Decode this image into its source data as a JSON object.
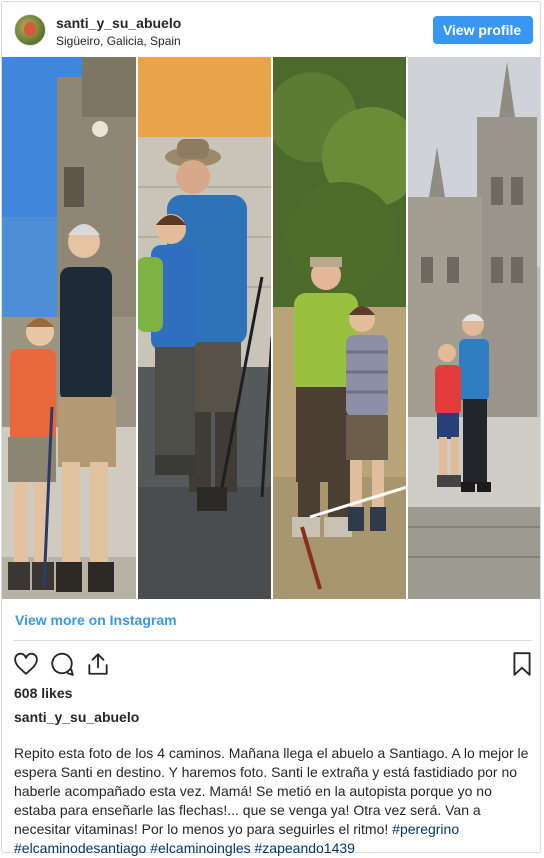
{
  "post": {
    "username": "santi_y_su_abuelo",
    "location": "Sigüeiro, Galicia, Spain",
    "view_profile_label": "View profile",
    "view_more_label": "View more on Instagram",
    "likes": "608 likes",
    "caption_user": "santi_y_su_abuelo",
    "caption_text": "Repito esta foto de los 4 caminos. Mañana llega el abuelo a Santiago. A lo mejor le espera Santi en destino. Y haremos foto. Santi le extraña y está fastidiado por no haberle acompañado esta vez. Mamá! Se metió en la autopista porque yo no estaba para enseñarle las flechas!... que se venga ya! Otra vez será. Van a necesitar vitaminas! Por lo menos yo para seguirles el ritmo!",
    "hashtags": [
      "#peregrino",
      "#elcaminodesantiago",
      "#elcaminoingles",
      "#zapeando1439"
    ]
  },
  "icons": {
    "like": "heart-icon",
    "comment": "comment-icon",
    "share": "share-icon",
    "save": "bookmark-icon"
  },
  "colors": {
    "accent": "#3897f0",
    "text": "#262626",
    "hashtag": "#00376b",
    "border": "#dbdbdb"
  }
}
